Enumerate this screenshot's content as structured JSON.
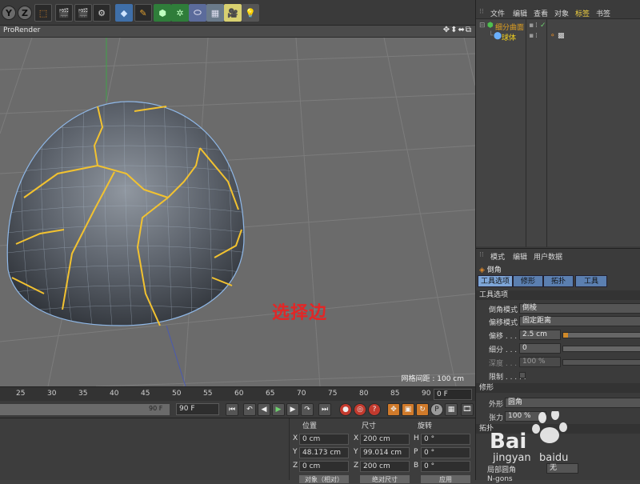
{
  "toolbar": {
    "axis_y": "Y",
    "axis_z": "Z",
    "icons": [
      "coord-system-icon",
      "render-view-icon",
      "render-picture-queue-icon",
      "render-settings-icon",
      "cube-icon",
      "pen-spline-icon",
      "subdivision-surface-icon",
      "array-icon",
      "deformer-icon",
      "floor-grid-icon",
      "camera-icon",
      "light-icon"
    ]
  },
  "viewport": {
    "title": "ProRender",
    "nav_icons": "✥⬍⬌⧉",
    "grid_distance": "网格间距 : 100 cm",
    "annotation": "选择边",
    "annotation_color": "#e32626"
  },
  "timeline": {
    "ticks": [
      "25",
      "30",
      "35",
      "40",
      "45",
      "50",
      "55",
      "60",
      "65",
      "70",
      "75",
      "80",
      "85",
      "90"
    ],
    "current_frame": "0 F",
    "range_end_a": "90 F",
    "range_end_b": "90 F"
  },
  "coords": {
    "headers": {
      "position": "位置",
      "size": "尺寸",
      "rotation": "旋转"
    },
    "rows": [
      {
        "pos_axis": "X",
        "pos_value": "0 cm",
        "size_axis": "X",
        "size_value": "200 cm",
        "rot_axis": "H",
        "rot_value": "0 °"
      },
      {
        "pos_axis": "Y",
        "pos_value": "48.173 cm",
        "size_axis": "Y",
        "size_value": "99.014 cm",
        "rot_axis": "P",
        "rot_value": "0 °"
      },
      {
        "pos_axis": "Z",
        "pos_value": "0 cm",
        "size_axis": "Z",
        "size_value": "200 cm",
        "rot_axis": "B",
        "rot_value": "0 °"
      }
    ],
    "btn_object": "对象（相对）",
    "btn_absolute": "绝对尺寸",
    "btn_apply": "应用"
  },
  "object_manager": {
    "menu": [
      "文件",
      "编辑",
      "查看",
      "对象",
      "标签",
      "书签"
    ],
    "objects": [
      {
        "name": "细分曲面",
        "color": "#e0a020"
      },
      {
        "name": "球体",
        "color": "#f0d020"
      }
    ]
  },
  "attribute_manager": {
    "menu": [
      "模式",
      "编辑",
      "用户数据"
    ],
    "tool_name": "倒角",
    "tabs": [
      "工具选项",
      "修形",
      "拓扑",
      "工具"
    ],
    "section_tool_options": "工具选项",
    "props": [
      {
        "label": "倒角模式",
        "value": "倒棱"
      },
      {
        "label": "偏移模式",
        "value": "固定距离"
      },
      {
        "label": "偏移 . . . . .",
        "value": "2.5 cm"
      },
      {
        "label": "细分 . . . . .",
        "value": "0"
      },
      {
        "label": "深度 . . . . .",
        "value": "100 %"
      },
      {
        "label": "限制 . . . . .",
        "value": ""
      }
    ],
    "offset_fraction": 0.06,
    "section_shaping": "修形",
    "shape_label": "外形",
    "shape_value": "圆角",
    "tension_label": "张力",
    "tension_value": "100 %",
    "section_topology": "拓扑",
    "corner_label": "局部圆角",
    "corner_value": "无",
    "last_label": "N-gons"
  },
  "watermark": {
    "line1": "Bai",
    "line2": "jingyan",
    "line3": "baidu"
  }
}
